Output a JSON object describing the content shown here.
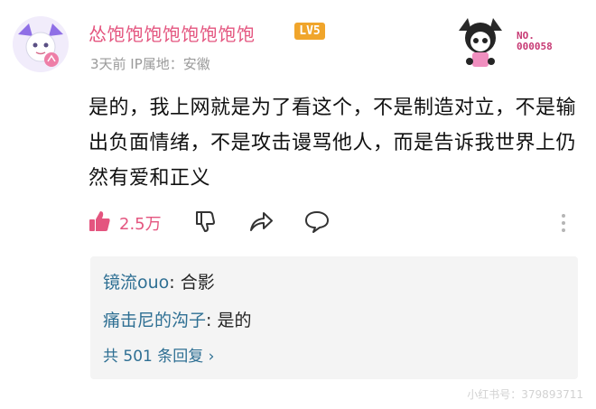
{
  "user": {
    "name": "怂饱饱饱饱饱饱饱饱",
    "level": "LV5",
    "meta": "3天前 IP属地：安徽"
  },
  "badge": {
    "no_label": "NO.",
    "no_value": "000058"
  },
  "comment": {
    "text": "是的，我上网就是为了看这个，不是制造对立，不是输出负面情绪，不是攻击谩骂他人，而是告诉我世界上仍然有爱和正义"
  },
  "actions": {
    "like_count": "2.5万",
    "icons": [
      "thumb-up-icon",
      "thumb-down-icon",
      "share-icon",
      "comment-icon",
      "more-icon"
    ]
  },
  "replies": {
    "items": [
      {
        "user": "镜流ouo",
        "text": "合影"
      },
      {
        "user": "痛击尼的沟子",
        "text": "是的"
      }
    ],
    "total_label": "共 501 条回复 ›"
  },
  "watermark": "小红书号：379893711",
  "colors": {
    "username": "#e4557f",
    "like": "#e4557f",
    "reply_user": "#2e6f93",
    "level_badge": "#f0a52b"
  }
}
